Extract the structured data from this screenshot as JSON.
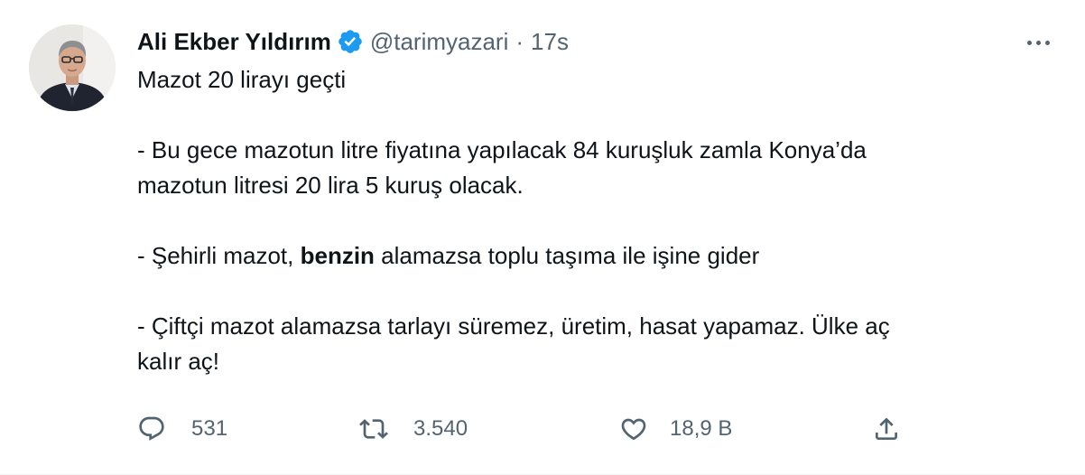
{
  "author": {
    "display_name": "Ali Ekber Yıldırım",
    "handle": "@tarimyazari",
    "separator": "·",
    "time": "17s",
    "verified": true
  },
  "tweet": {
    "line1": "Mazot 20 lirayı geçti",
    "line2": "- Bu gece mazotun litre fiyatına yapılacak 84 kuruşluk zamla Konya’da",
    "line3": "mazotun litresi 20 lira 5 kuruş olacak.",
    "line4_before": "- Şehirli mazot, ",
    "line4_bold": "benzin",
    "line4_after": " alamazsa toplu taşıma ile işine gider",
    "line5": "- Çiftçi mazot alamazsa tarlayı süremez, üretim, hasat yapamaz. Ülke aç",
    "line6": "kalır aç!"
  },
  "actions": {
    "reply_count": "531",
    "retweet_count": "3.540",
    "like_count": "18,9 B"
  },
  "icons": {
    "verified": "verified-badge-icon",
    "more": "more-horizontal-icon",
    "reply": "reply-bubble-icon",
    "retweet": "retweet-icon",
    "like": "heart-icon",
    "share": "share-upload-icon"
  },
  "colors": {
    "verified_blue": "#1d9bf0",
    "text_primary": "#0f1419",
    "text_secondary": "#536471"
  }
}
